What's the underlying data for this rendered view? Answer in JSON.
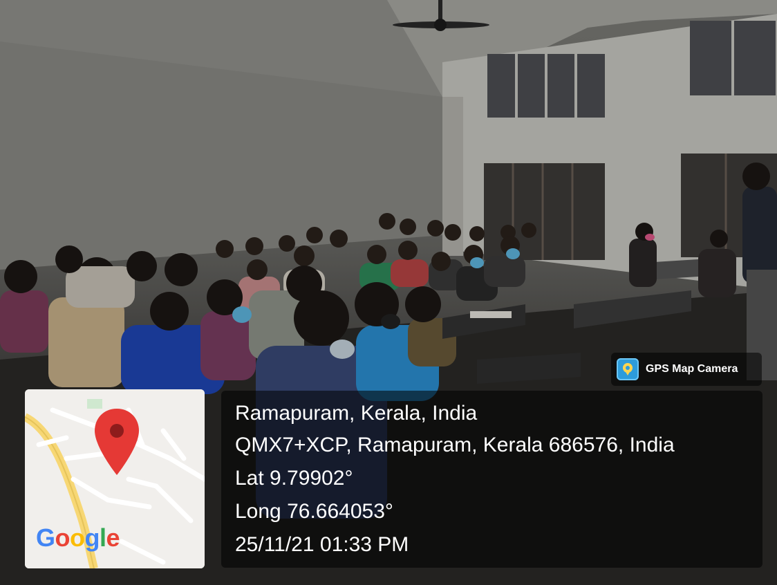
{
  "photo": {
    "subject": "classroom-photo"
  },
  "badge": {
    "app_name": "GPS Map Camera",
    "icon": "map-pin-camera-icon"
  },
  "location": {
    "place": "Ramapuram, Kerala, India",
    "address": "QMX7+XCP, Ramapuram, Kerala 686576, India",
    "latitude": "Lat 9.79902°",
    "longitude": "Long 76.664053°",
    "datetime": "25/11/21 01:33 PM"
  },
  "map": {
    "pin_icon": "location-pin-icon",
    "logo": [
      "G",
      "o",
      "o",
      "g",
      "l",
      "e"
    ],
    "colors": {
      "pin": "#e53935",
      "road_major": "#f7d774",
      "road_minor": "#ffffff"
    }
  }
}
